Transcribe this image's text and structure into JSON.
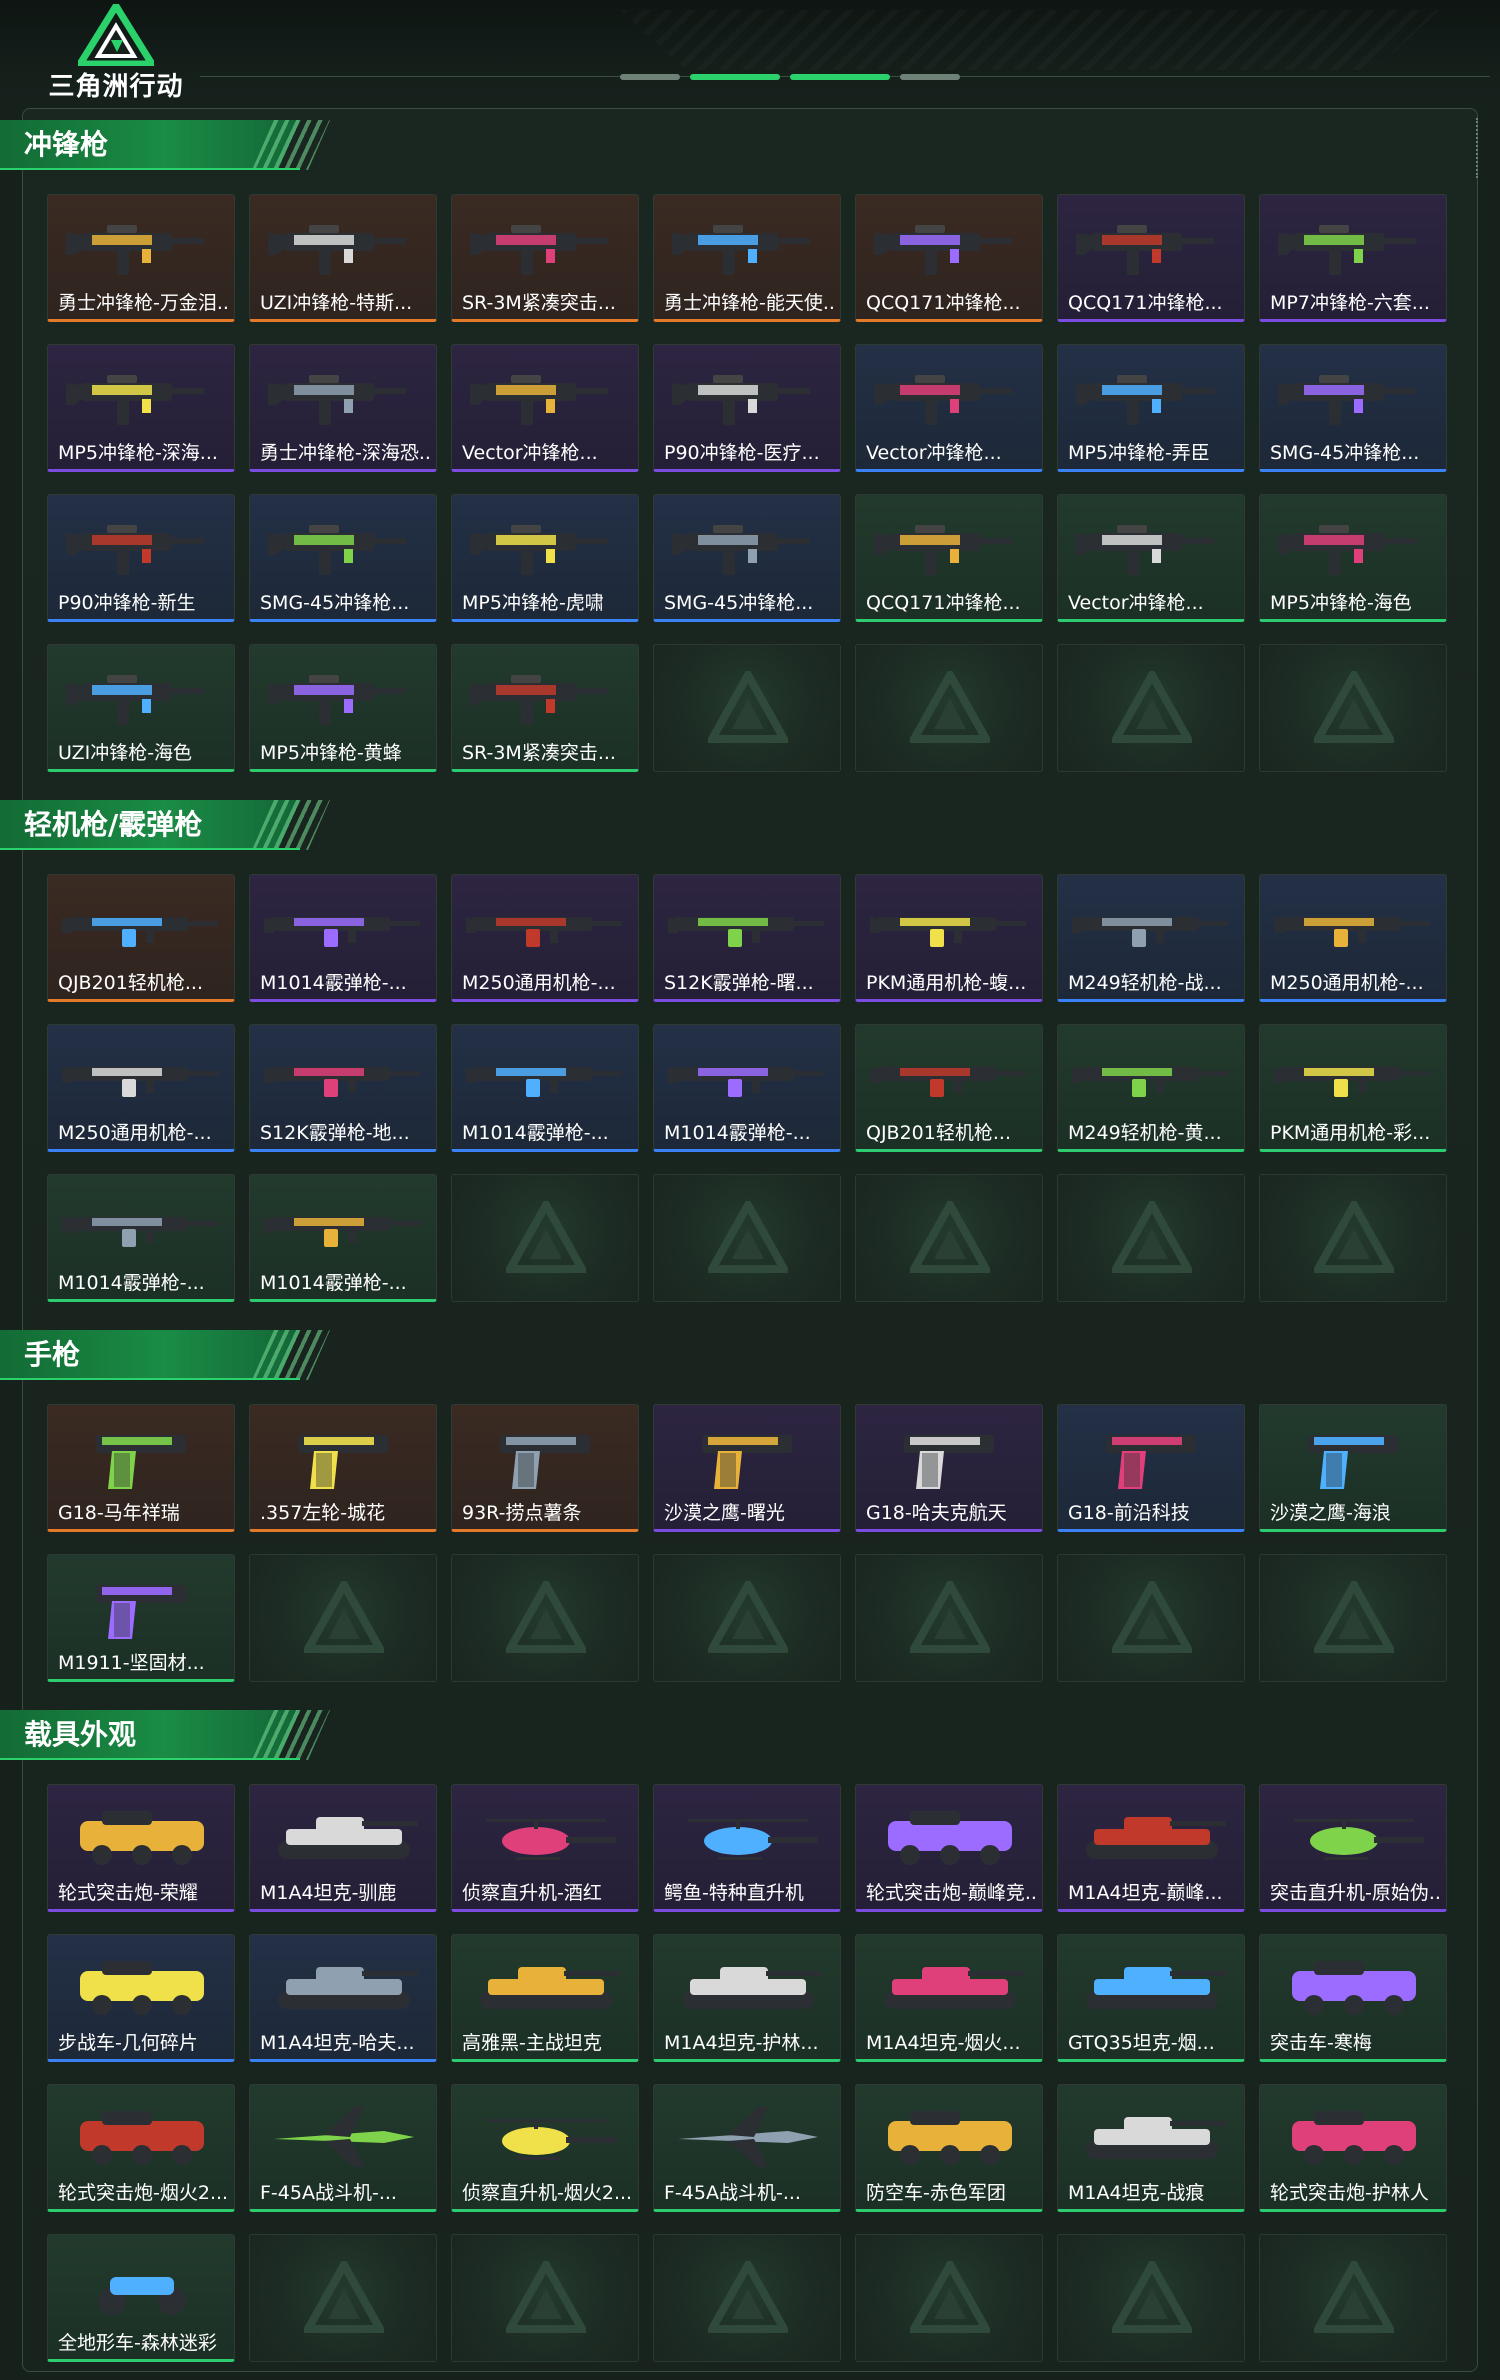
{
  "app": {
    "logo_text": "三角洲行动",
    "accent_color": "#2bd26b"
  },
  "rarity_colors": {
    "orange": "#e27a2a",
    "purple": "#7a4de0",
    "blue": "#3b82f6",
    "green": "#2ecc71"
  },
  "sections": [
    {
      "title": "冲锋枪",
      "icon": "smg",
      "slots": 28,
      "items": [
        {
          "name": "勇士冲锋枪-万金泪...",
          "rarity": "orange"
        },
        {
          "name": "UZI冲锋枪-特斯...",
          "rarity": "orange"
        },
        {
          "name": "SR-3M紧凑突击...",
          "rarity": "orange"
        },
        {
          "name": "勇士冲锋枪-能天使...",
          "rarity": "orange"
        },
        {
          "name": "QCQ171冲锋枪...",
          "rarity": "orange"
        },
        {
          "name": "QCQ171冲锋枪...",
          "rarity": "purple"
        },
        {
          "name": "MP7冲锋枪-六套...",
          "rarity": "purple"
        },
        {
          "name": "MP5冲锋枪-深海...",
          "rarity": "purple"
        },
        {
          "name": "勇士冲锋枪-深海恐...",
          "rarity": "purple"
        },
        {
          "name": "Vector冲锋枪...",
          "rarity": "purple"
        },
        {
          "name": "P90冲锋枪-医疗...",
          "rarity": "purple"
        },
        {
          "name": "Vector冲锋枪...",
          "rarity": "blue"
        },
        {
          "name": "MP5冲锋枪-弄臣",
          "rarity": "blue"
        },
        {
          "name": "SMG-45冲锋枪...",
          "rarity": "blue"
        },
        {
          "name": "P90冲锋枪-新生",
          "rarity": "blue"
        },
        {
          "name": "SMG-45冲锋枪...",
          "rarity": "blue"
        },
        {
          "name": "MP5冲锋枪-虎啸",
          "rarity": "blue"
        },
        {
          "name": "SMG-45冲锋枪...",
          "rarity": "blue"
        },
        {
          "name": "QCQ171冲锋枪...",
          "rarity": "green"
        },
        {
          "name": "Vector冲锋枪...",
          "rarity": "green"
        },
        {
          "name": "MP5冲锋枪-海色",
          "rarity": "green"
        },
        {
          "name": "UZI冲锋枪-海色",
          "rarity": "green"
        },
        {
          "name": "MP5冲锋枪-黄蜂",
          "rarity": "green"
        },
        {
          "name": "SR-3M紧凑突击...",
          "rarity": "green"
        }
      ]
    },
    {
      "title": "轻机枪/霰弹枪",
      "icon": "lmg",
      "slots": 21,
      "items": [
        {
          "name": "QJB201轻机枪...",
          "rarity": "orange"
        },
        {
          "name": "M1014霰弹枪-...",
          "rarity": "purple"
        },
        {
          "name": "M250通用机枪-...",
          "rarity": "purple"
        },
        {
          "name": "S12K霰弹枪-曙...",
          "rarity": "purple"
        },
        {
          "name": "PKM通用机枪-蝮...",
          "rarity": "purple"
        },
        {
          "name": "M249轻机枪-战...",
          "rarity": "blue"
        },
        {
          "name": "M250通用机枪-...",
          "rarity": "blue"
        },
        {
          "name": "M250通用机枪-...",
          "rarity": "blue"
        },
        {
          "name": "S12K霰弹枪-地...",
          "rarity": "blue"
        },
        {
          "name": "M1014霰弹枪-...",
          "rarity": "blue"
        },
        {
          "name": "M1014霰弹枪-...",
          "rarity": "blue"
        },
        {
          "name": "QJB201轻机枪...",
          "rarity": "green"
        },
        {
          "name": "M249轻机枪-黄...",
          "rarity": "green"
        },
        {
          "name": "PKM通用机枪-彩...",
          "rarity": "green"
        },
        {
          "name": "M1014霰弹枪-...",
          "rarity": "green"
        },
        {
          "name": "M1014霰弹枪-...",
          "rarity": "green"
        }
      ]
    },
    {
      "title": "手枪",
      "icon": "pistol",
      "slots": 14,
      "items": [
        {
          "name": "G18-马年祥瑞",
          "rarity": "orange"
        },
        {
          "name": ".357左轮-城花",
          "rarity": "orange"
        },
        {
          "name": "93R-捞点薯条",
          "rarity": "orange"
        },
        {
          "name": "沙漠之鹰-曙光",
          "rarity": "purple"
        },
        {
          "name": "G18-哈夫克航天",
          "rarity": "purple"
        },
        {
          "name": "G18-前沿科技",
          "rarity": "blue"
        },
        {
          "name": "沙漠之鹰-海浪",
          "rarity": "green"
        },
        {
          "name": "M1911-坚固材...",
          "rarity": "green"
        }
      ]
    },
    {
      "title": "载具外观",
      "icon": "vehicle",
      "slots": 28,
      "items": [
        {
          "name": "轮式突击炮-荣耀",
          "rarity": "purple",
          "kind": "car"
        },
        {
          "name": "M1A4坦克-驯鹿",
          "rarity": "purple",
          "kind": "tank"
        },
        {
          "name": "侦察直升机-酒红",
          "rarity": "purple",
          "kind": "heli"
        },
        {
          "name": "鳄鱼-特种直升机",
          "rarity": "purple",
          "kind": "heli"
        },
        {
          "name": "轮式突击炮-巅峰竞...",
          "rarity": "purple",
          "kind": "car"
        },
        {
          "name": "M1A4坦克-巅峰...",
          "rarity": "purple",
          "kind": "tank"
        },
        {
          "name": "突击直升机-原始伪...",
          "rarity": "purple",
          "kind": "heli"
        },
        {
          "name": "步战车-几何碎片",
          "rarity": "blue",
          "kind": "apc"
        },
        {
          "name": "M1A4坦克-哈夫...",
          "rarity": "blue",
          "kind": "tank"
        },
        {
          "name": "高雅黑-主战坦克",
          "rarity": "green",
          "kind": "tank"
        },
        {
          "name": "M1A4坦克-护林...",
          "rarity": "green",
          "kind": "tank"
        },
        {
          "name": "M1A4坦克-烟火...",
          "rarity": "green",
          "kind": "tank"
        },
        {
          "name": "GTQ35坦克-烟...",
          "rarity": "green",
          "kind": "tank"
        },
        {
          "name": "突击车-寒梅",
          "rarity": "green",
          "kind": "car"
        },
        {
          "name": "轮式突击炮-烟火2...",
          "rarity": "green",
          "kind": "car"
        },
        {
          "name": "F-45A战斗机-...",
          "rarity": "green",
          "kind": "jet"
        },
        {
          "name": "侦察直升机-烟火2...",
          "rarity": "green",
          "kind": "heli"
        },
        {
          "name": "F-45A战斗机-...",
          "rarity": "green",
          "kind": "jet"
        },
        {
          "name": "防空车-赤色军团",
          "rarity": "green",
          "kind": "apc"
        },
        {
          "name": "M1A4坦克-战痕",
          "rarity": "green",
          "kind": "tank"
        },
        {
          "name": "轮式突击炮-护林人",
          "rarity": "green",
          "kind": "car"
        },
        {
          "name": "全地形车-森林迷彩",
          "rarity": "green",
          "kind": "atv"
        }
      ]
    }
  ]
}
